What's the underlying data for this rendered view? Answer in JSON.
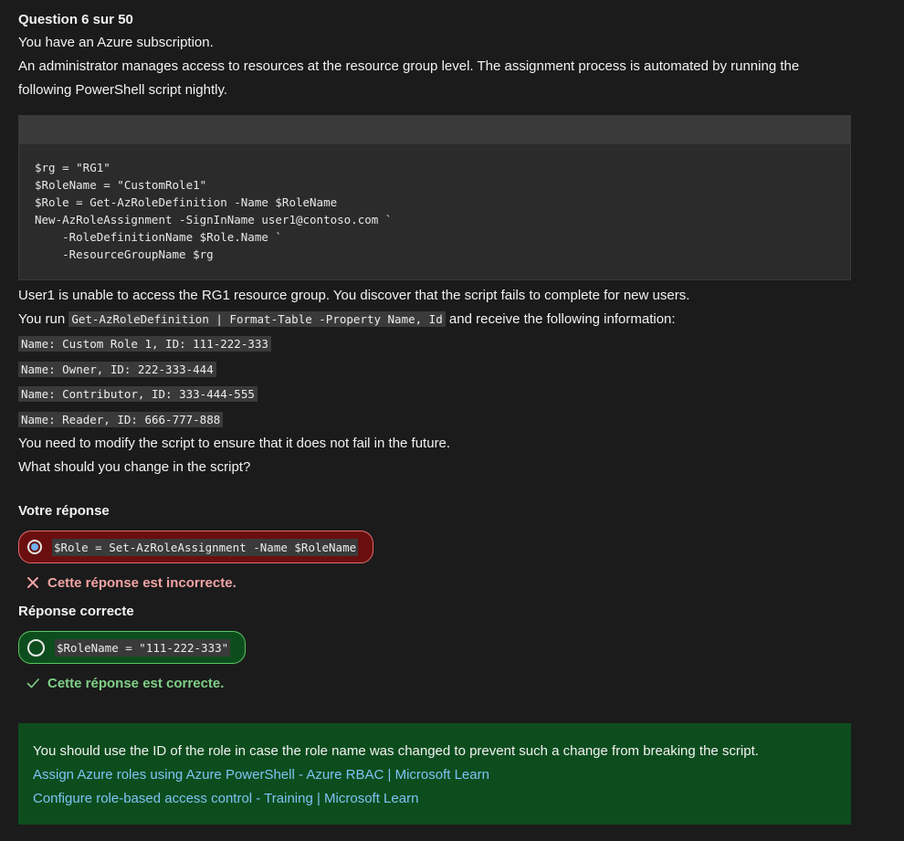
{
  "question": {
    "title": "Question 6 sur 50",
    "intro": "You have an Azure subscription.",
    "context": "An administrator manages access to resources at the resource group level. The assignment process is automated by running the following PowerShell script nightly.",
    "code": "$rg = \"RG1\"\n$RoleName = \"CustomRole1\"\n$Role = Get-AzRoleDefinition -Name $RoleName\nNew-AzRoleAssignment -SignInName user1@contoso.com `\n    -RoleDefinitionName $Role.Name `\n    -ResourceGroupName $rg",
    "problem": "User1 is unable to access the RG1 resource group. You discover that the script fails to complete for new users.",
    "run_prefix": "You run",
    "run_command": "Get-AzRoleDefinition | Format-Table -Property Name, Id",
    "run_suffix": "and receive the following information:",
    "outputs": [
      "Name: Custom Role 1, ID: 111-222-333",
      "Name: Owner, ID: 222-333-444",
      "Name: Contributor, ID: 333-444-555",
      "Name: Reader, ID: 666-777-888"
    ],
    "need": "You need to modify the script to ensure that it does not fail in the future.",
    "ask": "What should you change in the script?"
  },
  "your_answer": {
    "label": "Votre réponse",
    "code": "$Role = Set-AzRoleAssignment -Name $RoleName",
    "feedback": "Cette réponse est incorrecte."
  },
  "correct_answer": {
    "label": "Réponse correcte",
    "code": "$RoleName = \"111-222-333\"",
    "feedback": "Cette réponse est correcte."
  },
  "explanation": {
    "text": "You should use the ID of the role in case the role name was changed to prevent such a change from breaking the script.",
    "links": [
      "Assign Azure roles using Azure PowerShell - Azure RBAC | Microsoft Learn",
      "Configure role-based access control - Training | Microsoft Learn"
    ]
  },
  "colors": {
    "background": "#1b1b1b",
    "wrong_bg": "#6a0f0f",
    "wrong_border": "#e06a6a",
    "right_bg": "#0d4d1d",
    "right_border": "#59c463",
    "link": "#7ec3f5"
  }
}
